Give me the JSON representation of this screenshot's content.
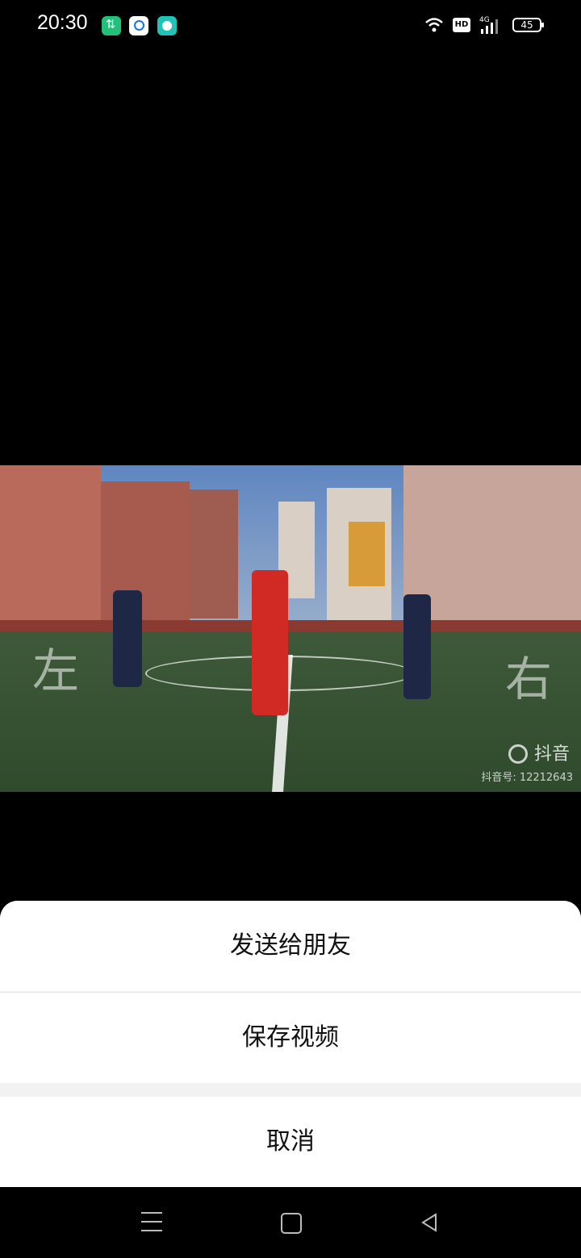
{
  "status": {
    "time": "20:30",
    "hd": "HD",
    "network": "4G",
    "battery": "45"
  },
  "video": {
    "overlay_left": "左",
    "overlay_right": "右",
    "watermark_brand": "抖音",
    "watermark_id": "抖音号: 12212643"
  },
  "sheet": {
    "send_label": "发送给朋友",
    "save_label": "保存视频",
    "cancel_label": "取消"
  },
  "icons": {
    "status_app1": "transfer-icon",
    "status_app2": "search-icon",
    "status_app3": "chat-icon",
    "wifi": "wifi-icon",
    "signal": "signal-icon",
    "battery": "battery-icon",
    "nav_menu": "menu-icon",
    "nav_home": "home-icon",
    "nav_back": "back-icon"
  }
}
